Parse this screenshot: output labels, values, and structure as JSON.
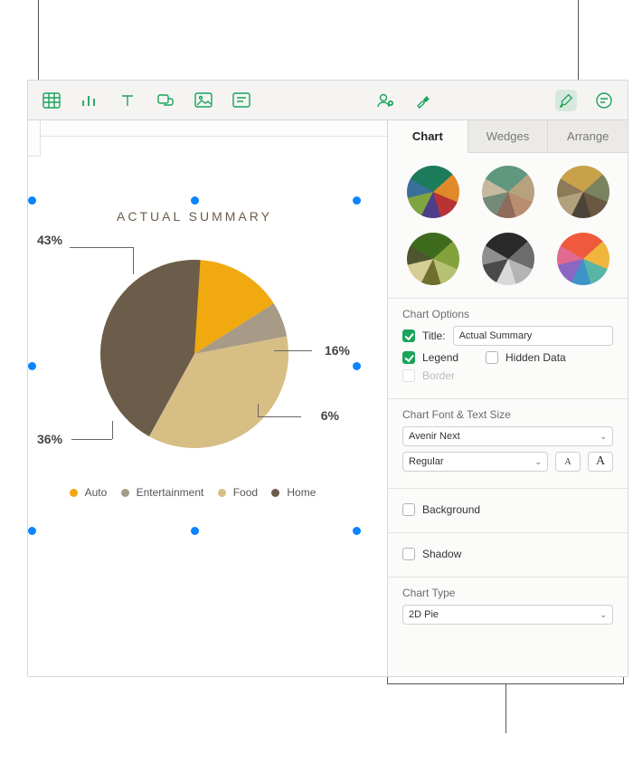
{
  "chart_data": {
    "type": "pie",
    "title": "ACTUAL SUMMARY",
    "series": [
      {
        "name": "Auto",
        "value_pct": 16,
        "color": "#f0a90e"
      },
      {
        "name": "Entertainment",
        "value_pct": 6,
        "color": "#a79a86"
      },
      {
        "name": "Food",
        "value_pct": 36,
        "color": "#d7be84"
      },
      {
        "name": "Home",
        "value_pct": 43,
        "color": "#6b5d49"
      }
    ],
    "labels": {
      "home": "43%",
      "food": "36%",
      "auto": "16%",
      "ent": "6%"
    }
  },
  "legend": {
    "auto": "Auto",
    "ent": "Entertainment",
    "food": "Food",
    "home": "Home"
  },
  "sidebar": {
    "tabs": {
      "chart": "Chart",
      "wedges": "Wedges",
      "arrange": "Arrange"
    },
    "style_presets": [
      {
        "colors": [
          "#1c7b5a",
          "#e0892b",
          "#b73333",
          "#4e3d8b",
          "#7fa540",
          "#3a6f9a"
        ]
      },
      {
        "colors": [
          "#5f977f",
          "#b6a37e",
          "#b98e6f",
          "#8d6a5a",
          "#738a78",
          "#c7b9a0"
        ]
      },
      {
        "colors": [
          "#c8a14a",
          "#7a8360",
          "#6b5840",
          "#4b4438",
          "#b3a07c",
          "#8d7a56"
        ]
      },
      {
        "colors": [
          "#3f6b1f",
          "#83a23c",
          "#b8c076",
          "#6f6f2e",
          "#d6cd96",
          "#4d5630"
        ]
      },
      {
        "colors": [
          "#2a2a2a",
          "#6c6c6c",
          "#b4b4b4",
          "#d9d9d9",
          "#4a4a4a",
          "#8f8f8f"
        ]
      },
      {
        "colors": [
          "#f05a3c",
          "#f0b53c",
          "#57b6a5",
          "#3e94c8",
          "#8b67c3",
          "#e06a90"
        ]
      }
    ],
    "chart_options": {
      "title": "Chart Options",
      "title_label": "Title:",
      "title_value": "Actual Summary",
      "legend": "Legend",
      "hidden_data": "Hidden Data",
      "border": "Border"
    },
    "font": {
      "title": "Chart Font & Text Size",
      "family": "Avenir Next",
      "weight": "Regular"
    },
    "background": "Background",
    "shadow": "Shadow",
    "chart_type": {
      "title": "Chart Type",
      "value": "2D Pie"
    }
  }
}
